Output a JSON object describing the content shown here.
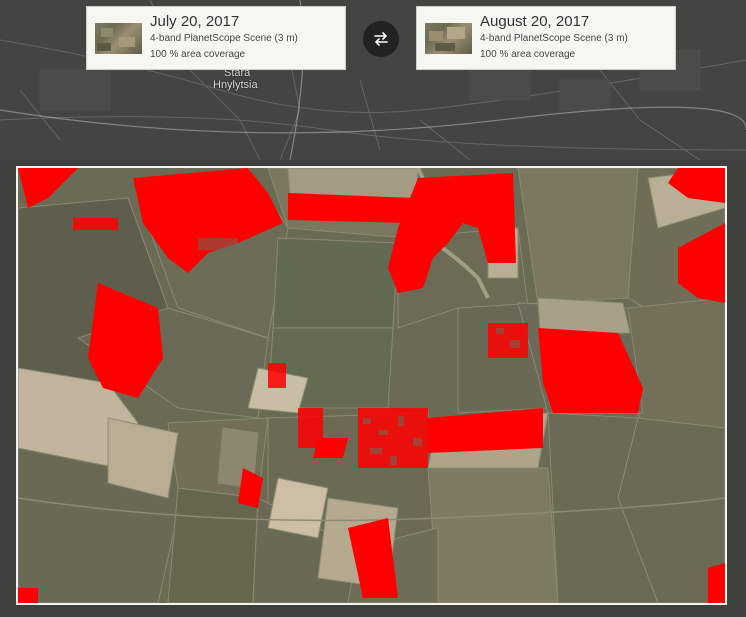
{
  "map": {
    "place_label_line1": "Stara",
    "place_label_line2": "Hnylytsia"
  },
  "left_scene": {
    "date": "July 20, 2017",
    "type": "4-band PlanetScope Scene (3 m)",
    "coverage": "100 % area coverage"
  },
  "right_scene": {
    "date": "August 20, 2017",
    "type": "4-band PlanetScope Scene (3 m)",
    "coverage": "100 % area coverage"
  },
  "swap_button": {
    "icon": "swap-arrows-icon"
  },
  "colors": {
    "change_highlight": "#ff0000",
    "card_bg": "#f7f7f2",
    "map_bg": "#3d3f3b"
  }
}
